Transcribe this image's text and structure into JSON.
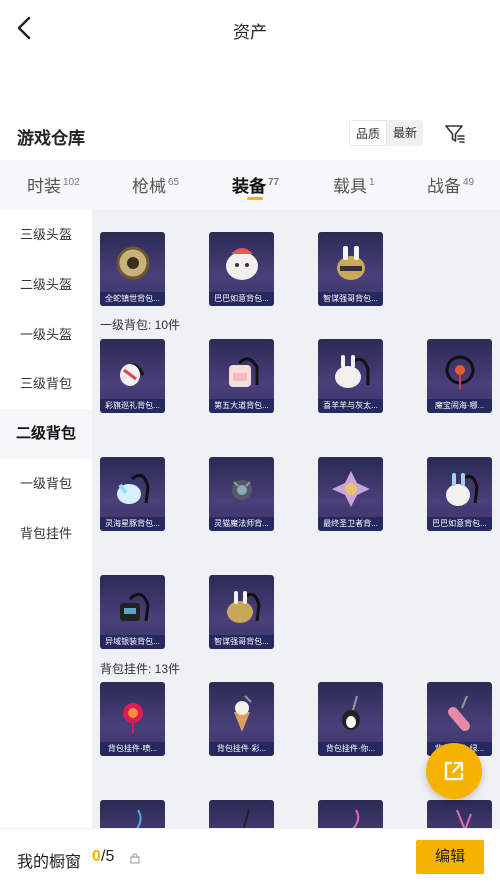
{
  "header": {
    "title": "资产"
  },
  "warehouse": {
    "title": "游戏仓库",
    "sort_options": [
      "品质",
      "最新"
    ]
  },
  "tabs": [
    {
      "label": "时装",
      "count": "102"
    },
    {
      "label": "枪械",
      "count": "65"
    },
    {
      "label": "装备",
      "count": "77"
    },
    {
      "label": "载具",
      "count": "1"
    },
    {
      "label": "战备",
      "count": "49"
    }
  ],
  "sidebar": {
    "items": [
      "三级头盔",
      "二级头盔",
      "一级头盔",
      "三级背包",
      "二级背包",
      "一级背包",
      "背包挂件"
    ],
    "active_index": 4
  },
  "sections": [
    {
      "label": "",
      "items": [
        "全蛇镇世背包...",
        "巴巴如意背包...",
        "智谋强哥背包..."
      ]
    },
    {
      "label": "一级背包: 10件",
      "items": [
        "彩旗巡礼背包...",
        "第五大道背包...",
        "喜羊羊与灰太...",
        "魔宝闹海·哪...",
        "灵海星豚背包...",
        "灵猫魔法师背...",
        "最终圣卫者背...",
        "巴巴如意背包...",
        "异域银装背包...",
        "智谋强哥背包..."
      ]
    },
    {
      "label": "背包挂件: 13件",
      "items": [
        "背包挂件·喷...",
        "背包挂件·彩...",
        "背包挂件·你...",
        "背包挂件·绿...",
        "",
        "",
        "",
        ""
      ]
    }
  ],
  "bottom": {
    "showcase_label": "我的橱窗",
    "current": "0",
    "total": "/5",
    "edit_label": "编辑"
  },
  "colors": {
    "accent": "#f5b300",
    "card_bg": "#2b2b55"
  }
}
